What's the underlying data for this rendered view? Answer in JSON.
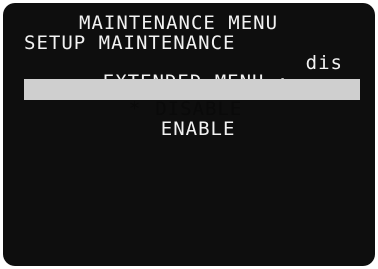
{
  "menu": {
    "title": "MAINTENANCE MENU",
    "section": "SETUP MAINTENANCE",
    "item_label": "EXTENDED MENU :",
    "item_value": "dis",
    "options": [
      {
        "label": "DISABLE",
        "selected": true,
        "marker": "*"
      },
      {
        "label": "ENABLE",
        "selected": false,
        "marker": ""
      }
    ]
  },
  "colors": {
    "screen_bg": "#0e0e0e",
    "text": "#f2f2f2",
    "highlight": "#cfcfcf",
    "highlight_text": "#0a0a0a"
  }
}
